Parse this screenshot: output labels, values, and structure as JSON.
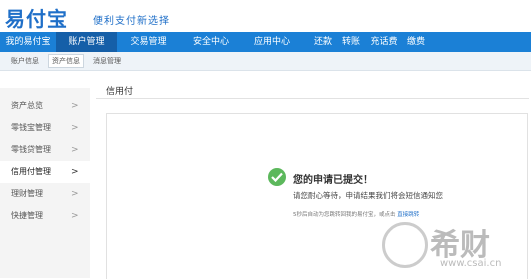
{
  "brand": {
    "logo": "易付宝",
    "slogan": "便利支付新选择"
  },
  "nav": {
    "primary": [
      {
        "label": "我的易付宝",
        "active": false
      },
      {
        "label": "账户管理",
        "active": true
      },
      {
        "label": "交易管理",
        "active": false
      },
      {
        "label": "安全中心",
        "active": false
      },
      {
        "label": "应用中心",
        "active": false
      }
    ],
    "quick": [
      "还款",
      "转账",
      "充话费",
      "缴费"
    ]
  },
  "subnav": [
    {
      "label": "账户信息",
      "active": false
    },
    {
      "label": "资产信息",
      "active": true
    },
    {
      "label": "消息管理",
      "active": false
    }
  ],
  "sidebar": [
    {
      "label": "资产总览",
      "active": false
    },
    {
      "label": "零钱宝管理",
      "active": false
    },
    {
      "label": "零钱贷管理",
      "active": false
    },
    {
      "label": "信用付管理",
      "active": true
    },
    {
      "label": "理财管理",
      "active": false
    },
    {
      "label": "快捷管理",
      "active": false
    }
  ],
  "content": {
    "title": "信用付",
    "message_title": "您的申请已提交！",
    "message_desc": "请您耐心等待，申请结果我们将会短信通知您",
    "redirect_text": "5秒后自动为您跳转回我的易付宝，或点击",
    "redirect_link": "直接跳转"
  },
  "watermark": {
    "text": "希财",
    "url": "www.csai.cn"
  },
  "colors": {
    "nav": "#1b80d6",
    "nav_active": "#155fa8",
    "success": "#5cb85c",
    "brand": "#1f6fc8"
  }
}
